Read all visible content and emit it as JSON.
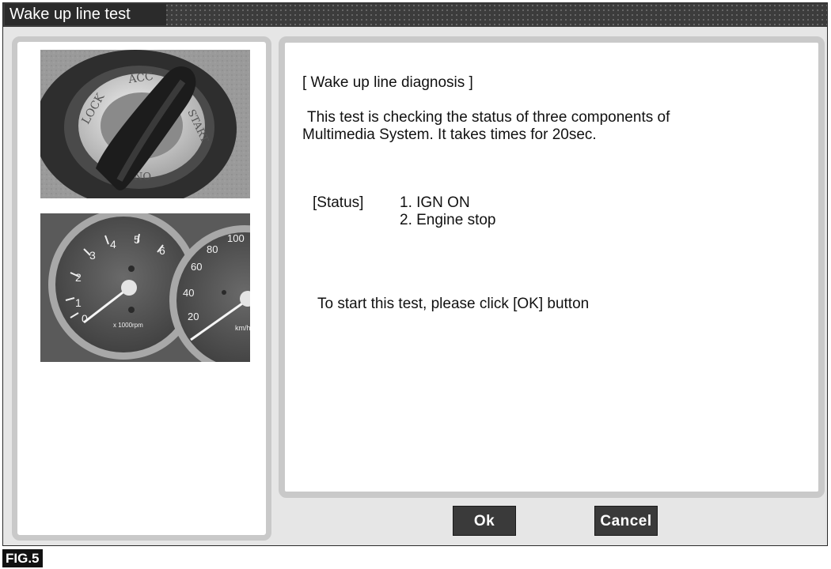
{
  "window": {
    "title": "Wake up line test"
  },
  "content": {
    "heading": "[ Wake up line diagnosis ]",
    "description_line1": "This test is checking the status of three components of",
    "description_line2": "Multimedia System. It takes times for 20sec.",
    "status_label": "[Status]",
    "status_items": [
      "1. IGN ON",
      "2. Engine stop"
    ],
    "instruction": "To start this test, please click [OK] button"
  },
  "images": {
    "ignition_labels": [
      "LOCK",
      "ACC",
      "START",
      "ON"
    ],
    "tach_labels": [
      "0",
      "1",
      "2",
      "3",
      "4",
      "5",
      "6"
    ],
    "tach_unit": "x 1000rpm",
    "speedo_labels": [
      "20",
      "40",
      "60",
      "80",
      "100"
    ],
    "speedo_unit": "km/h"
  },
  "buttons": {
    "ok": "Ok",
    "cancel": "Cancel"
  },
  "figure_label": "FIG.5"
}
